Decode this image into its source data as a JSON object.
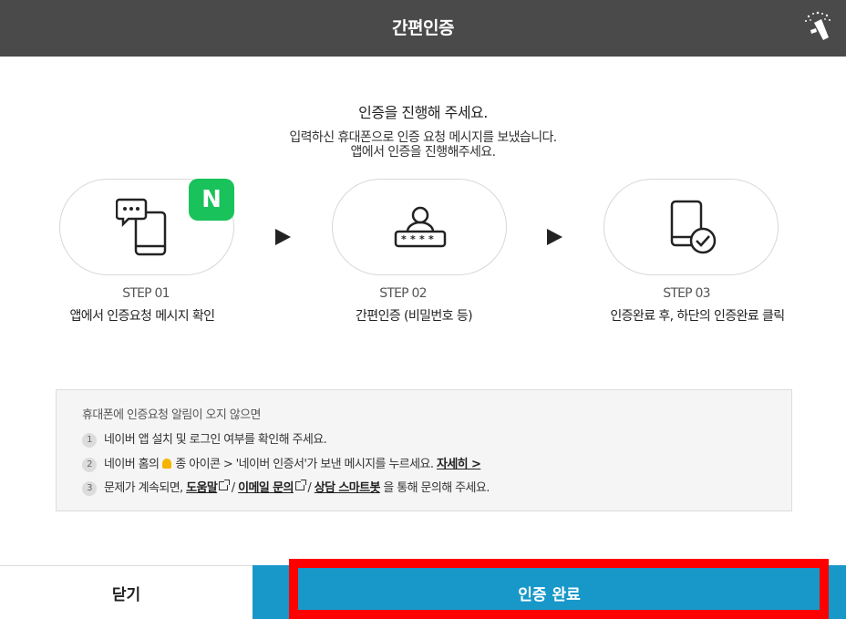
{
  "header": {
    "title": "간편인증",
    "icon": "wand-sparkle-icon"
  },
  "intro": {
    "title": "인증을 진행해 주세요.",
    "line1": "입력하신 휴대폰으로 인증 요청 메시지를 보냈습니다.",
    "line2": "앱에서 인증을 진행해주세요."
  },
  "steps": [
    {
      "num": "STEP 01",
      "desc": "앱에서 인증요청 메시지 확인",
      "icon": "chat-phone-icon",
      "badge": "N"
    },
    {
      "num": "STEP 02",
      "desc": "간편인증 (비밀번호 등)",
      "icon": "user-password-icon"
    },
    {
      "num": "STEP 03",
      "desc": "인증완료 후, 하단의 인증완료 클릭",
      "icon": "phone-check-icon"
    }
  ],
  "info": {
    "title": "휴대폰에 인증요청 알림이 오지 않으면",
    "items": [
      {
        "num": "1",
        "text": "네이버 앱 설치 및 로그인 여부를 확인해 주세요."
      },
      {
        "num": "2",
        "text_a": "네이버 홈의",
        "text_b": "종 아이콘 > '네이버 인증서'가 보낸 메시지를 누르세요.",
        "link": "자세히 >"
      },
      {
        "num": "3",
        "text_a": "문제가 계속되면,",
        "link_help": "도움말",
        "link_email": "이메일 문의",
        "link_bot": "상담 스마트봇",
        "text_b": "을 통해 문의해 주세요.",
        "sep": "/"
      }
    ]
  },
  "buttons": {
    "close": "닫기",
    "complete": "인증 완료"
  },
  "colors": {
    "header_bg": "#4a4a4a",
    "primary": "#1898c9",
    "naver_green": "#19c25a",
    "highlight": "#ff0000"
  }
}
